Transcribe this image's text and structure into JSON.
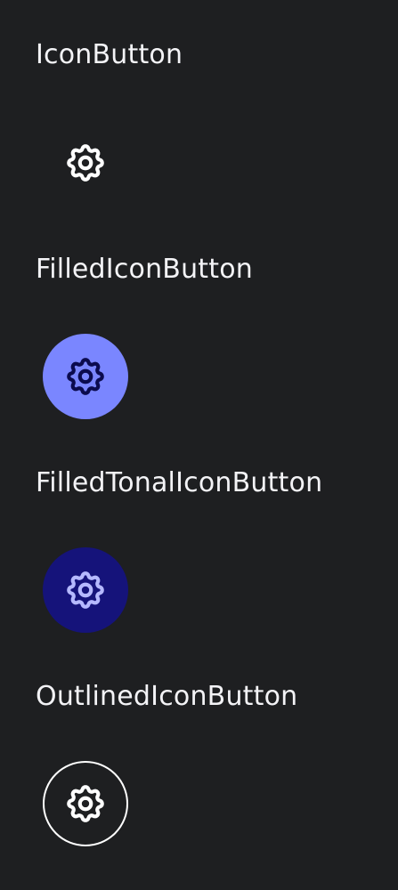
{
  "theme": {
    "background": "#1e1f21",
    "text": "#f3f3f6"
  },
  "sections": [
    {
      "title": "IconButton",
      "button": {
        "icon": "settings-gear-icon",
        "container": "transparent",
        "icon_color": "#ffffff",
        "outline": "none"
      }
    },
    {
      "title": "FilledIconButton",
      "button": {
        "icon": "settings-gear-icon",
        "container": "#7a86ff",
        "icon_color": "#0b0b4e",
        "outline": "none"
      }
    },
    {
      "title": "FilledTonalIconButton",
      "button": {
        "icon": "settings-gear-icon",
        "container": "#15137a",
        "icon_color": "#b5b9ff",
        "outline": "none"
      }
    },
    {
      "title": "OutlinedIconButton",
      "button": {
        "icon": "settings-gear-icon",
        "container": "transparent",
        "icon_color": "#ffffff",
        "outline": "#ffffff"
      }
    }
  ]
}
